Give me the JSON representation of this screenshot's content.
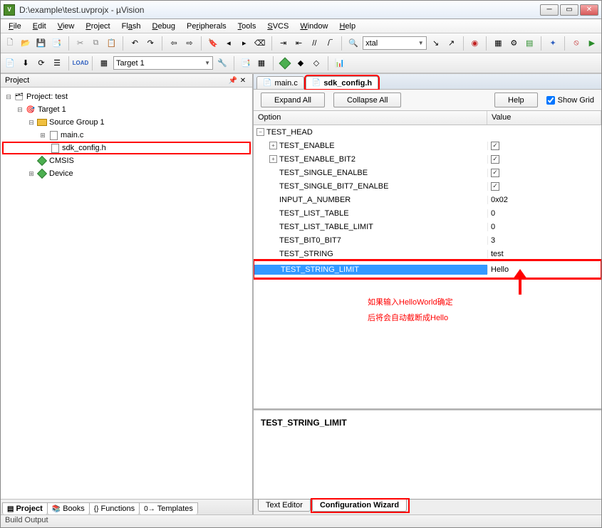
{
  "window": {
    "title": "D:\\example\\test.uvprojx - µVision"
  },
  "menu": [
    "File",
    "Edit",
    "View",
    "Project",
    "Flash",
    "Debug",
    "Peripherals",
    "Tools",
    "SVCS",
    "Window",
    "Help"
  ],
  "toolbar2": {
    "target_select": "Target 1"
  },
  "oscillator": {
    "value": "xtal"
  },
  "project_panel": {
    "title": "Project",
    "root": "Project: test",
    "target": "Target 1",
    "group": "Source Group 1",
    "files": [
      "main.c",
      "sdk_config.h"
    ],
    "extras": [
      "CMSIS",
      "Device"
    ],
    "bottom_tabs": [
      "Project",
      "Books",
      "Functions",
      "Templates"
    ]
  },
  "editor": {
    "tabs": [
      {
        "name": "main.c",
        "icon": "file"
      },
      {
        "name": "sdk_config.h",
        "icon": "hfile",
        "active": true,
        "highlight": true
      }
    ]
  },
  "wizard": {
    "buttons": {
      "expand": "Expand All",
      "collapse": "Collapse All",
      "help": "Help"
    },
    "showgrid_label": "Show Grid",
    "showgrid_checked": true,
    "headers": {
      "option": "Option",
      "value": "Value"
    },
    "root": "TEST_HEAD",
    "rows": [
      {
        "name": "TEST_ENABLE",
        "exp": true,
        "value_kind": "check",
        "checked": true
      },
      {
        "name": "TEST_ENABLE_BIT2",
        "exp": true,
        "value_kind": "check",
        "checked": true
      },
      {
        "name": "TEST_SINGLE_ENALBE",
        "value_kind": "check",
        "checked": true
      },
      {
        "name": "TEST_SINGLE_BIT7_ENALBE",
        "value_kind": "check",
        "checked": true
      },
      {
        "name": "INPUT_A_NUMBER",
        "value_kind": "text",
        "value": "0x02"
      },
      {
        "name": "TEST_LIST_TABLE",
        "value_kind": "text",
        "value": "0"
      },
      {
        "name": "TEST_LIST_TABLE_LIMIT",
        "value_kind": "text",
        "value": "0"
      },
      {
        "name": "TEST_BIT0_BIT7",
        "value_kind": "text",
        "value": "3"
      },
      {
        "name": "TEST_STRING",
        "value_kind": "text",
        "value": "test"
      },
      {
        "name": "TEST_STRING_LIMIT",
        "value_kind": "edit",
        "value": "Hello",
        "selected": true,
        "highlight": true
      }
    ],
    "desc": "TEST_STRING_LIMIT",
    "bottom_tabs": [
      "Text Editor",
      "Configuration Wizard"
    ]
  },
  "annotation": {
    "line1": "如果输入HelloWorld确定",
    "line2": "后将会自动截断成Hello"
  },
  "status": "Build Output"
}
